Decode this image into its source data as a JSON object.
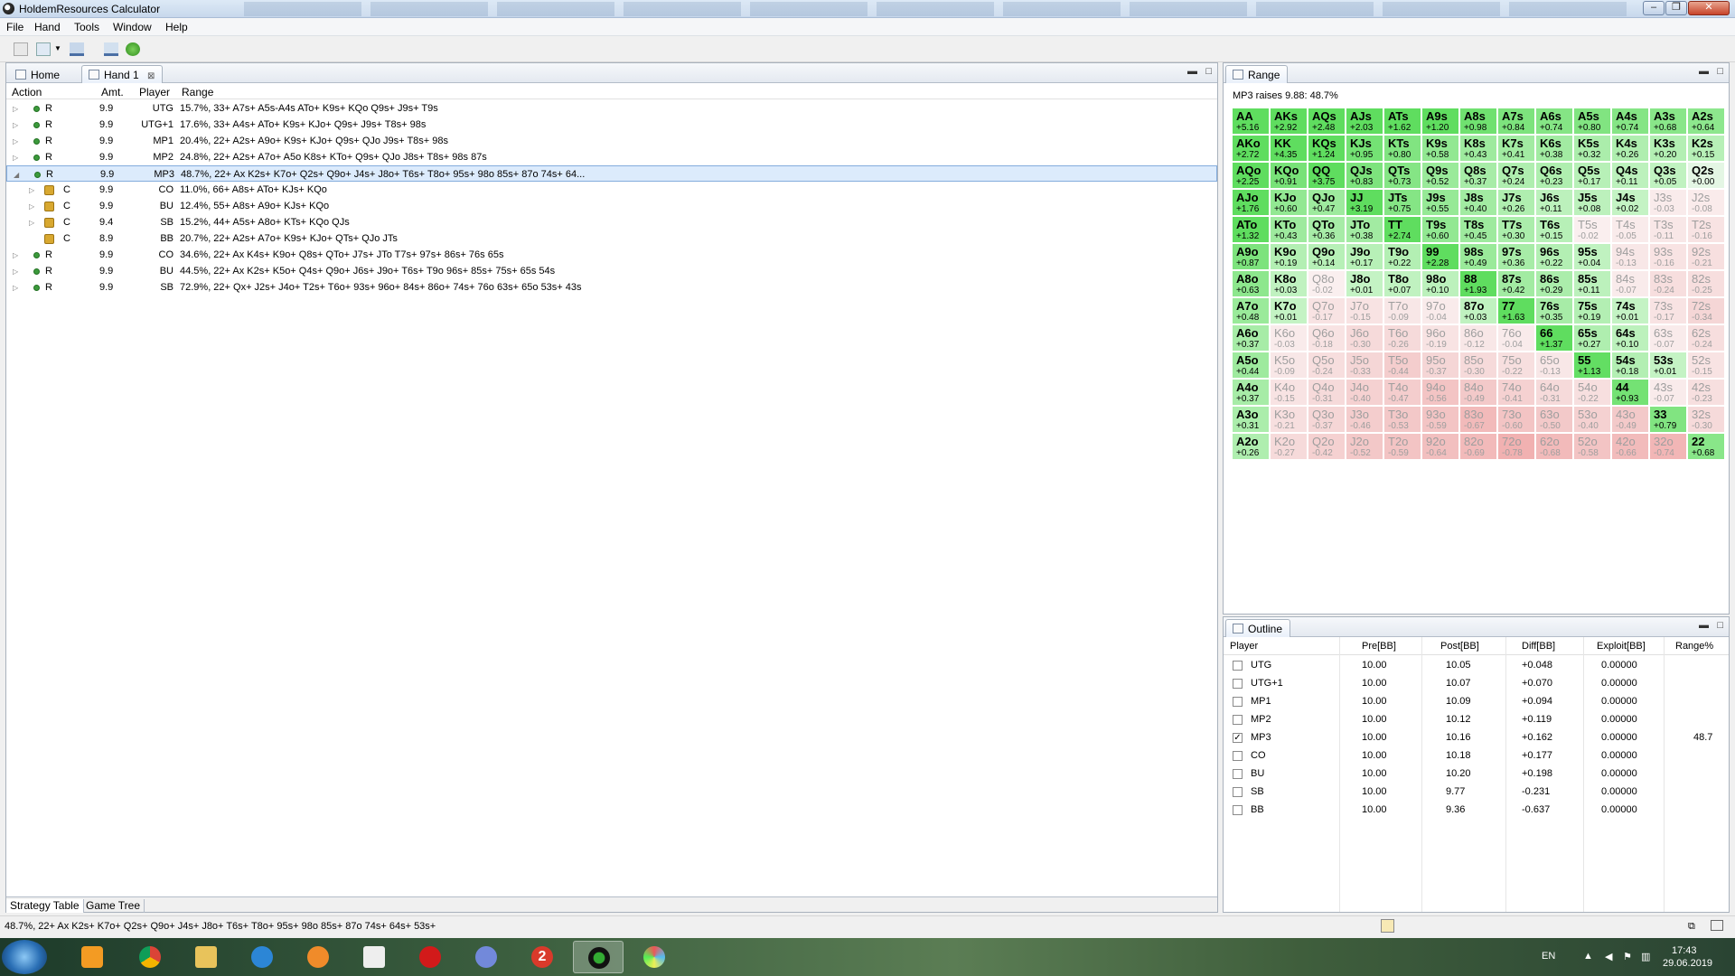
{
  "window": {
    "title": "HoldemResources Calculator"
  },
  "menu": [
    "File",
    "Hand",
    "Tools",
    "Window",
    "Help"
  ],
  "left_tabs": [
    {
      "label": "Home"
    },
    {
      "label": "Hand 1"
    }
  ],
  "columns": [
    "Action",
    "Amt.",
    "Player",
    "Range"
  ],
  "rows": [
    {
      "action": "R",
      "amt": "9.9",
      "player": "UTG",
      "range": "15.7%, 33+ A7s+ A5s-A4s ATo+ K9s+ KQo Q9s+ J9s+ T9s",
      "expand": "▷",
      "icon": "dot",
      "indent": 0
    },
    {
      "action": "R",
      "amt": "9.9",
      "player": "UTG+1",
      "range": "17.6%, 33+ A4s+ ATo+ K9s+ KJo+ Q9s+ J9s+ T8s+ 98s",
      "expand": "▷",
      "icon": "dot",
      "indent": 0
    },
    {
      "action": "R",
      "amt": "9.9",
      "player": "MP1",
      "range": "20.4%, 22+ A2s+ A9o+ K9s+ KJo+ Q9s+ QJo J9s+ T8s+ 98s",
      "expand": "▷",
      "icon": "dot",
      "indent": 0
    },
    {
      "action": "R",
      "amt": "9.9",
      "player": "MP2",
      "range": "24.8%, 22+ A2s+ A7o+ A5o K8s+ KTo+ Q9s+ QJo J8s+ T8s+ 98s 87s",
      "expand": "▷",
      "icon": "dot",
      "indent": 0
    },
    {
      "action": "R",
      "amt": "9.9",
      "player": "MP3",
      "range": "48.7%, 22+ Ax K2s+ K7o+ Q2s+ Q9o+ J4s+ J8o+ T6s+ T8o+ 95s+ 98o 85s+ 87o 74s+ 64...",
      "expand": "◢",
      "icon": "dot",
      "indent": 0,
      "selected": true
    },
    {
      "action": "C",
      "amt": "9.9",
      "player": "CO",
      "range": "11.0%, 66+ A8s+ ATo+ KJs+ KQo",
      "expand": "▷",
      "icon": "lock",
      "indent": 1
    },
    {
      "action": "C",
      "amt": "9.9",
      "player": "BU",
      "range": "12.4%, 55+ A8s+ A9o+ KJs+ KQo",
      "expand": "▷",
      "icon": "lock",
      "indent": 1
    },
    {
      "action": "C",
      "amt": "9.4",
      "player": "SB",
      "range": "15.2%, 44+ A5s+ A8o+ KTs+ KQo QJs",
      "expand": "▷",
      "icon": "lock",
      "indent": 1
    },
    {
      "action": "C",
      "amt": "8.9",
      "player": "BB",
      "range": "20.7%, 22+ A2s+ A7o+ K9s+ KJo+ QTs+ QJo JTs",
      "expand": "",
      "icon": "lock",
      "indent": 1
    },
    {
      "action": "R",
      "amt": "9.9",
      "player": "CO",
      "range": "34.6%, 22+ Ax K4s+ K9o+ Q8s+ QTo+ J7s+ JTo T7s+ 97s+ 86s+ 76s 65s",
      "expand": "▷",
      "icon": "dot",
      "indent": 0
    },
    {
      "action": "R",
      "amt": "9.9",
      "player": "BU",
      "range": "44.5%, 22+ Ax K2s+ K5o+ Q4s+ Q9o+ J6s+ J9o+ T6s+ T9o 96s+ 85s+ 75s+ 65s 54s",
      "expand": "▷",
      "icon": "dot",
      "indent": 0
    },
    {
      "action": "R",
      "amt": "9.9",
      "player": "SB",
      "range": "72.9%, 22+ Qx+ J2s+ J4o+ T2s+ T6o+ 93s+ 96o+ 84s+ 86o+ 74s+ 76o 63s+ 65o 53s+ 43s",
      "expand": "▷",
      "icon": "dot",
      "indent": 0
    }
  ],
  "bottom_tabs": [
    "Strategy Table",
    "Game Tree"
  ],
  "range_panel": {
    "tab": "Range",
    "title": "MP3 raises 9.88: 48.7%"
  },
  "range_grid": [
    [
      [
        "AA",
        "+5.16"
      ],
      [
        "AKs",
        "+2.92"
      ],
      [
        "AQs",
        "+2.48"
      ],
      [
        "AJs",
        "+2.03"
      ],
      [
        "ATs",
        "+1.62"
      ],
      [
        "A9s",
        "+1.20"
      ],
      [
        "A8s",
        "+0.98"
      ],
      [
        "A7s",
        "+0.84"
      ],
      [
        "A6s",
        "+0.74"
      ],
      [
        "A5s",
        "+0.80"
      ],
      [
        "A4s",
        "+0.74"
      ],
      [
        "A3s",
        "+0.68"
      ],
      [
        "A2s",
        "+0.64"
      ]
    ],
    [
      [
        "AKo",
        "+2.72"
      ],
      [
        "KK",
        "+4.35"
      ],
      [
        "KQs",
        "+1.24"
      ],
      [
        "KJs",
        "+0.95"
      ],
      [
        "KTs",
        "+0.80"
      ],
      [
        "K9s",
        "+0.58"
      ],
      [
        "K8s",
        "+0.43"
      ],
      [
        "K7s",
        "+0.41"
      ],
      [
        "K6s",
        "+0.38"
      ],
      [
        "K5s",
        "+0.32"
      ],
      [
        "K4s",
        "+0.26"
      ],
      [
        "K3s",
        "+0.20"
      ],
      [
        "K2s",
        "+0.15"
      ]
    ],
    [
      [
        "AQo",
        "+2.25"
      ],
      [
        "KQo",
        "+0.91"
      ],
      [
        "QQ",
        "+3.75"
      ],
      [
        "QJs",
        "+0.83"
      ],
      [
        "QTs",
        "+0.73"
      ],
      [
        "Q9s",
        "+0.52"
      ],
      [
        "Q8s",
        "+0.37"
      ],
      [
        "Q7s",
        "+0.24"
      ],
      [
        "Q6s",
        "+0.23"
      ],
      [
        "Q5s",
        "+0.17"
      ],
      [
        "Q4s",
        "+0.11"
      ],
      [
        "Q3s",
        "+0.05"
      ],
      [
        "Q2s",
        "+0.00"
      ]
    ],
    [
      [
        "AJo",
        "+1.76"
      ],
      [
        "KJo",
        "+0.60"
      ],
      [
        "QJo",
        "+0.47"
      ],
      [
        "JJ",
        "+3.19"
      ],
      [
        "JTs",
        "+0.75"
      ],
      [
        "J9s",
        "+0.55"
      ],
      [
        "J8s",
        "+0.40"
      ],
      [
        "J7s",
        "+0.26"
      ],
      [
        "J6s",
        "+0.11"
      ],
      [
        "J5s",
        "+0.08"
      ],
      [
        "J4s",
        "+0.02"
      ],
      [
        "J3s",
        "-0.03"
      ],
      [
        "J2s",
        "-0.08"
      ]
    ],
    [
      [
        "ATo",
        "+1.32"
      ],
      [
        "KTo",
        "+0.43"
      ],
      [
        "QTo",
        "+0.36"
      ],
      [
        "JTo",
        "+0.38"
      ],
      [
        "TT",
        "+2.74"
      ],
      [
        "T9s",
        "+0.60"
      ],
      [
        "T8s",
        "+0.45"
      ],
      [
        "T7s",
        "+0.30"
      ],
      [
        "T6s",
        "+0.15"
      ],
      [
        "T5s",
        "-0.02"
      ],
      [
        "T4s",
        "-0.05"
      ],
      [
        "T3s",
        "-0.11"
      ],
      [
        "T2s",
        "-0.16"
      ]
    ],
    [
      [
        "A9o",
        "+0.87"
      ],
      [
        "K9o",
        "+0.19"
      ],
      [
        "Q9o",
        "+0.14"
      ],
      [
        "J9o",
        "+0.17"
      ],
      [
        "T9o",
        "+0.22"
      ],
      [
        "99",
        "+2.28"
      ],
      [
        "98s",
        "+0.49"
      ],
      [
        "97s",
        "+0.36"
      ],
      [
        "96s",
        "+0.22"
      ],
      [
        "95s",
        "+0.04"
      ],
      [
        "94s",
        "-0.13"
      ],
      [
        "93s",
        "-0.16"
      ],
      [
        "92s",
        "-0.21"
      ]
    ],
    [
      [
        "A8o",
        "+0.63"
      ],
      [
        "K8o",
        "+0.03"
      ],
      [
        "Q8o",
        "-0.02"
      ],
      [
        "J8o",
        "+0.01"
      ],
      [
        "T8o",
        "+0.07"
      ],
      [
        "98o",
        "+0.10"
      ],
      [
        "88",
        "+1.93"
      ],
      [
        "87s",
        "+0.42"
      ],
      [
        "86s",
        "+0.29"
      ],
      [
        "85s",
        "+0.11"
      ],
      [
        "84s",
        "-0.07"
      ],
      [
        "83s",
        "-0.24"
      ],
      [
        "82s",
        "-0.25"
      ]
    ],
    [
      [
        "A7o",
        "+0.48"
      ],
      [
        "K7o",
        "+0.01"
      ],
      [
        "Q7o",
        "-0.17"
      ],
      [
        "J7o",
        "-0.15"
      ],
      [
        "T7o",
        "-0.09"
      ],
      [
        "97o",
        "-0.04"
      ],
      [
        "87o",
        "+0.03"
      ],
      [
        "77",
        "+1.63"
      ],
      [
        "76s",
        "+0.35"
      ],
      [
        "75s",
        "+0.19"
      ],
      [
        "74s",
        "+0.01"
      ],
      [
        "73s",
        "-0.17"
      ],
      [
        "72s",
        "-0.34"
      ]
    ],
    [
      [
        "A6o",
        "+0.37"
      ],
      [
        "K6o",
        "-0.03"
      ],
      [
        "Q6o",
        "-0.18"
      ],
      [
        "J6o",
        "-0.30"
      ],
      [
        "T6o",
        "-0.26"
      ],
      [
        "96o",
        "-0.19"
      ],
      [
        "86o",
        "-0.12"
      ],
      [
        "76o",
        "-0.04"
      ],
      [
        "66",
        "+1.37"
      ],
      [
        "65s",
        "+0.27"
      ],
      [
        "64s",
        "+0.10"
      ],
      [
        "63s",
        "-0.07"
      ],
      [
        "62s",
        "-0.24"
      ]
    ],
    [
      [
        "A5o",
        "+0.44"
      ],
      [
        "K5o",
        "-0.09"
      ],
      [
        "Q5o",
        "-0.24"
      ],
      [
        "J5o",
        "-0.33"
      ],
      [
        "T5o",
        "-0.44"
      ],
      [
        "95o",
        "-0.37"
      ],
      [
        "85o",
        "-0.30"
      ],
      [
        "75o",
        "-0.22"
      ],
      [
        "65o",
        "-0.13"
      ],
      [
        "55",
        "+1.13"
      ],
      [
        "54s",
        "+0.18"
      ],
      [
        "53s",
        "+0.01"
      ],
      [
        "52s",
        "-0.15"
      ]
    ],
    [
      [
        "A4o",
        "+0.37"
      ],
      [
        "K4o",
        "-0.15"
      ],
      [
        "Q4o",
        "-0.31"
      ],
      [
        "J4o",
        "-0.40"
      ],
      [
        "T4o",
        "-0.47"
      ],
      [
        "94o",
        "-0.56"
      ],
      [
        "84o",
        "-0.49"
      ],
      [
        "74o",
        "-0.41"
      ],
      [
        "64o",
        "-0.31"
      ],
      [
        "54o",
        "-0.22"
      ],
      [
        "44",
        "+0.93"
      ],
      [
        "43s",
        "-0.07"
      ],
      [
        "42s",
        "-0.23"
      ]
    ],
    [
      [
        "A3o",
        "+0.31"
      ],
      [
        "K3o",
        "-0.21"
      ],
      [
        "Q3o",
        "-0.37"
      ],
      [
        "J3o",
        "-0.46"
      ],
      [
        "T3o",
        "-0.53"
      ],
      [
        "93o",
        "-0.59"
      ],
      [
        "83o",
        "-0.67"
      ],
      [
        "73o",
        "-0.60"
      ],
      [
        "63o",
        "-0.50"
      ],
      [
        "53o",
        "-0.40"
      ],
      [
        "43o",
        "-0.49"
      ],
      [
        "33",
        "+0.79"
      ],
      [
        "32s",
        "-0.30"
      ]
    ],
    [
      [
        "A2o",
        "+0.26"
      ],
      [
        "K2o",
        "-0.27"
      ],
      [
        "Q2o",
        "-0.42"
      ],
      [
        "J2o",
        "-0.52"
      ],
      [
        "T2o",
        "-0.59"
      ],
      [
        "92o",
        "-0.64"
      ],
      [
        "82o",
        "-0.69"
      ],
      [
        "72o",
        "-0.78"
      ],
      [
        "62o",
        "-0.68"
      ],
      [
        "52o",
        "-0.58"
      ],
      [
        "42o",
        "-0.66"
      ],
      [
        "32o",
        "-0.74"
      ],
      [
        "22",
        "+0.68"
      ]
    ]
  ],
  "outline": {
    "tab": "Outline",
    "columns": [
      "Player",
      "Pre[BB]",
      "Post[BB]",
      "Diff[BB]",
      "Exploit[BB]",
      "Range%"
    ],
    "rows": [
      {
        "player": "UTG",
        "pre": "10.00",
        "post": "10.05",
        "diff": "+0.048",
        "exploit": "0.00000",
        "range": "",
        "checked": false
      },
      {
        "player": "UTG+1",
        "pre": "10.00",
        "post": "10.07",
        "diff": "+0.070",
        "exploit": "0.00000",
        "range": "",
        "checked": false
      },
      {
        "player": "MP1",
        "pre": "10.00",
        "post": "10.09",
        "diff": "+0.094",
        "exploit": "0.00000",
        "range": "",
        "checked": false
      },
      {
        "player": "MP2",
        "pre": "10.00",
        "post": "10.12",
        "diff": "+0.119",
        "exploit": "0.00000",
        "range": "",
        "checked": false
      },
      {
        "player": "MP3",
        "pre": "10.00",
        "post": "10.16",
        "diff": "+0.162",
        "exploit": "0.00000",
        "range": "48.7",
        "checked": true
      },
      {
        "player": "CO",
        "pre": "10.00",
        "post": "10.18",
        "diff": "+0.177",
        "exploit": "0.00000",
        "range": "",
        "checked": false
      },
      {
        "player": "BU",
        "pre": "10.00",
        "post": "10.20",
        "diff": "+0.198",
        "exploit": "0.00000",
        "range": "",
        "checked": false
      },
      {
        "player": "SB",
        "pre": "10.00",
        "post": "9.77",
        "diff": "-0.231",
        "exploit": "0.00000",
        "range": "",
        "checked": false
      },
      {
        "player": "BB",
        "pre": "10.00",
        "post": "9.36",
        "diff": "-0.637",
        "exploit": "0.00000",
        "range": "",
        "checked": false
      }
    ]
  },
  "status": {
    "text": "48.7%, 22+ Ax K2s+ K7o+ Q2s+ Q9o+ J4s+ J8o+ T6s+ T8o+ 95s+ 98o 85s+ 87o 74s+ 64s+ 53s+"
  },
  "taskbar": {
    "lang": "EN",
    "time": "17:43",
    "date": "29.06.2019",
    "badge": "2"
  },
  "colors": {
    "positive": "#5fe05f",
    "negative": "#f6c9c9",
    "selected_row": "#dcebfc"
  }
}
